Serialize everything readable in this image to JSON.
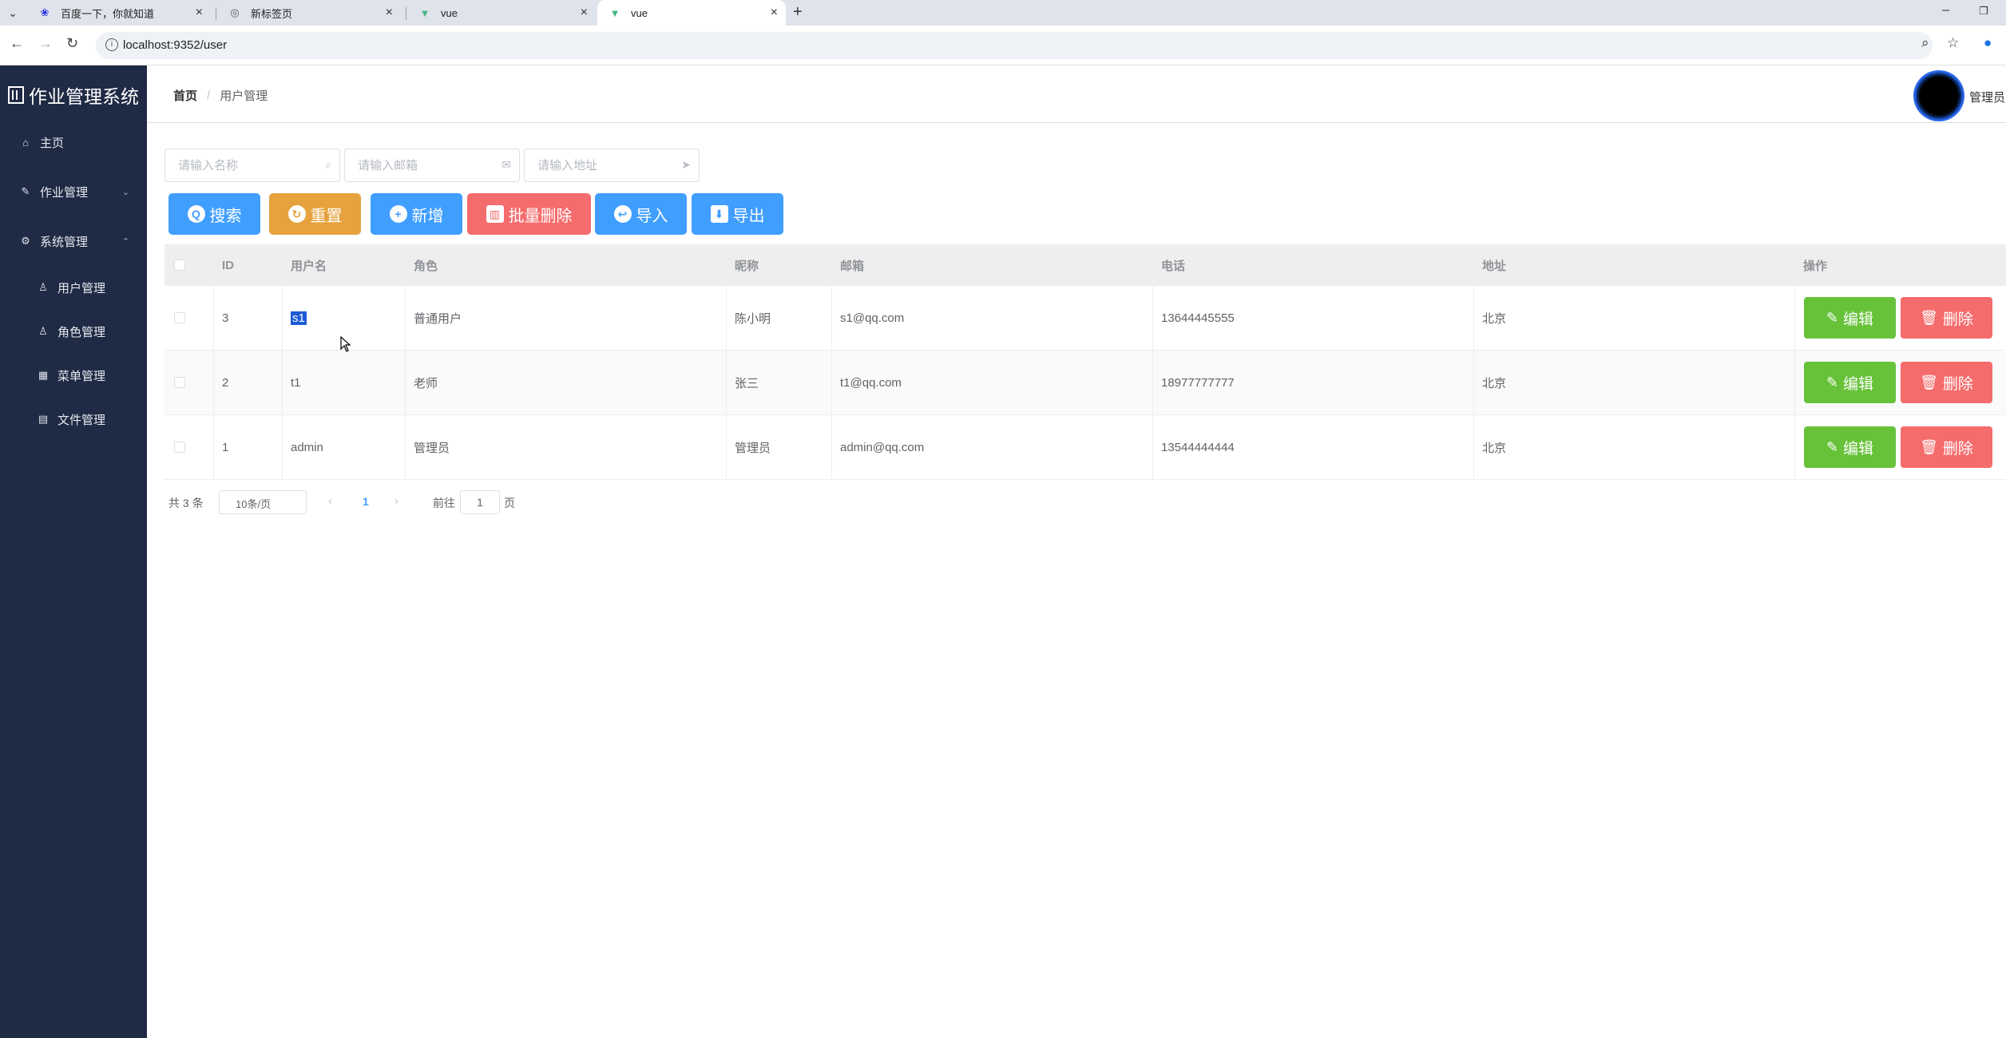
{
  "browser": {
    "tabs": [
      {
        "title": "百度一下，你就知道",
        "icon": "baidu-icon"
      },
      {
        "title": "新标签页",
        "icon": "chrome-icon"
      },
      {
        "title": "vue",
        "icon": "vue-icon"
      },
      {
        "title": "vue",
        "icon": "vue-icon"
      }
    ],
    "url": "localhost:9352/user"
  },
  "sidebar": {
    "title": "作业管理系统",
    "items": [
      {
        "label": "主页",
        "icon": "home-icon"
      },
      {
        "label": "作业管理",
        "icon": "edit-icon",
        "arrow": "chevron-down"
      },
      {
        "label": "系统管理",
        "icon": "gear-icon",
        "arrow": "chevron-up"
      },
      {
        "label": "用户管理",
        "icon": "user-icon"
      },
      {
        "label": "角色管理",
        "icon": "user-outline-icon"
      },
      {
        "label": "菜单管理",
        "icon": "grid-icon"
      },
      {
        "label": "文件管理",
        "icon": "document-icon"
      }
    ]
  },
  "header": {
    "breadcrumb_home": "首页",
    "breadcrumb_sep": "/",
    "breadcrumb_current": "用户管理",
    "user_name": "管理员"
  },
  "search": {
    "name_placeholder": "请输入名称",
    "email_placeholder": "请输入邮箱",
    "address_placeholder": "请输入地址"
  },
  "toolbar": {
    "search": "搜索",
    "reset": "重置",
    "add": "新增",
    "batch_delete": "批量删除",
    "import": "导入",
    "export": "导出"
  },
  "table": {
    "columns": [
      "ID",
      "用户名",
      "角色",
      "昵称",
      "邮箱",
      "电话",
      "地址",
      "操作"
    ],
    "rows": [
      {
        "id": "3",
        "username": "s1",
        "role": "普通用户",
        "nickname": "陈小明",
        "email": "s1@qq.com",
        "phone": "13644445555",
        "address": "北京"
      },
      {
        "id": "2",
        "username": "t1",
        "role": "老师",
        "nickname": "张三",
        "email": "t1@qq.com",
        "phone": "18977777777",
        "address": "北京"
      },
      {
        "id": "1",
        "username": "admin",
        "role": "管理员",
        "nickname": "管理员",
        "email": "admin@qq.com",
        "phone": "13544444444",
        "address": "北京"
      }
    ],
    "edit_label": "编辑",
    "delete_label": "删除"
  },
  "pagination": {
    "total": "共 3 条",
    "page_size": "10条/页",
    "current_page": "1",
    "goto_label": "前往",
    "goto_value": "1",
    "goto_unit": "页"
  },
  "colors": {
    "sidebar_bg": "#1f2a44",
    "primary": "#409eff",
    "warning": "#e6a23c",
    "danger": "#f56c6c",
    "success": "#67c23a"
  }
}
